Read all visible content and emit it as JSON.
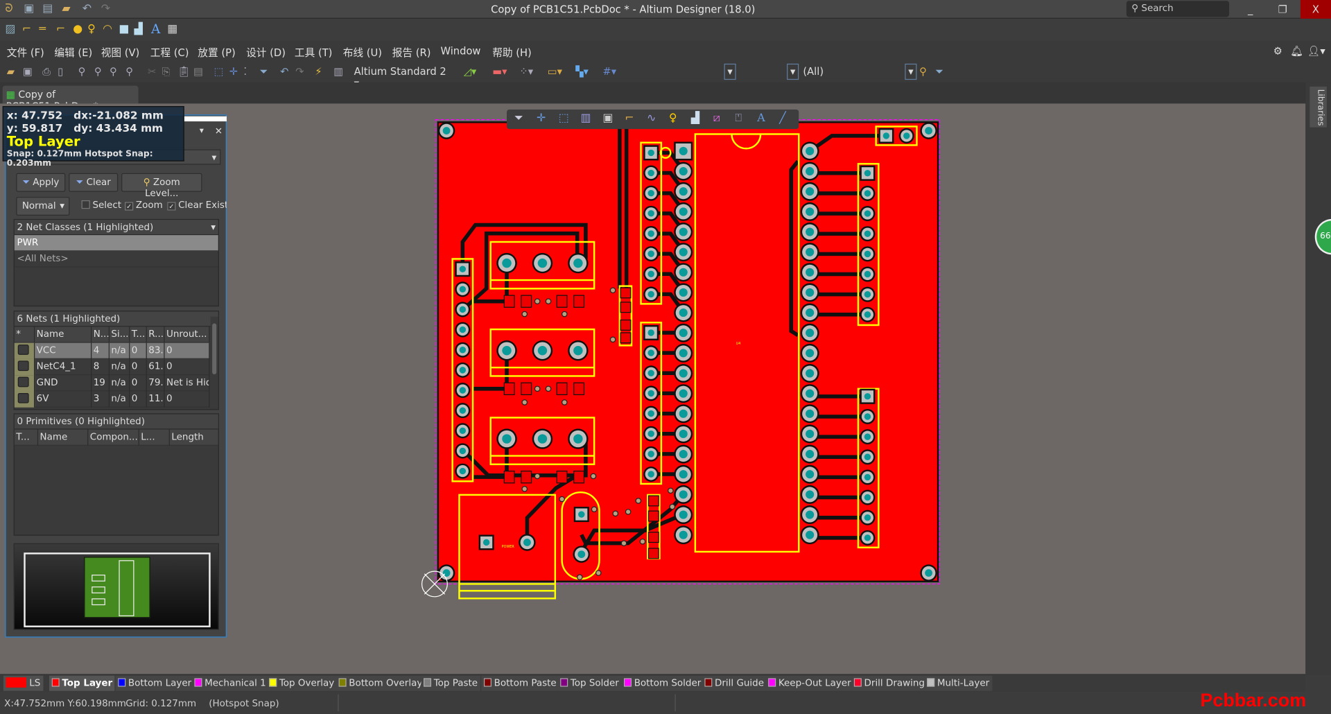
{
  "window": {
    "title": "Copy of PCB1C51.PcbDoc * - Altium Designer (18.0)",
    "search_placeholder": "Search",
    "minimize": "_",
    "restore": "❐",
    "close": "X"
  },
  "menu": [
    "文件 (F)",
    "编辑 (E)",
    "视图 (V)",
    "工程 (C)",
    "放置 (P)",
    "设计 (D)",
    "工具 (T)",
    "布线 (U)",
    "报告 (R)",
    "Window",
    "帮助 (H)"
  ],
  "toolbar": {
    "standard_combo": "Altium Standard 2",
    "filter_combo": "(All)"
  },
  "document_tab": "Copy of PCB1C51.PcbDoc *",
  "side_tab": "Libraries",
  "side_widget": "66",
  "hud": {
    "x": "x: 47.752",
    "dx": "dx:-21.082 mm",
    "y": "y: 59.817",
    "dy": "dy: 43.434 mm",
    "layer": "Top Layer",
    "snap": "Snap: 0.127mm Hotspot Snap: 0.203mm"
  },
  "panel": {
    "apply": "Apply",
    "clear": "Clear",
    "zoom_level": "Zoom Level...",
    "mode": "Normal",
    "select": "Select",
    "zoom": "Zoom",
    "clear_existing": "Clear Existing",
    "select_checked": false,
    "zoom_checked": true,
    "clear_existing_checked": true,
    "net_classes": {
      "header": "2 Net Classes (1 Highlighted)",
      "items": [
        "PWR",
        "<All Nets>"
      ],
      "selected": "PWR"
    },
    "nets": {
      "header": "6 Nets (1 Highlighted)",
      "columns": [
        "*",
        "Name",
        "N...",
        "Si...",
        "T...",
        "R...",
        "Unrout..."
      ],
      "rows": [
        [
          "VCC",
          "4",
          "n/a",
          "0",
          "83.:",
          "0"
        ],
        [
          "NetC4_1",
          "8",
          "n/a",
          "0",
          "61.",
          "0"
        ],
        [
          "GND",
          "19",
          "n/a",
          "0",
          "79.:",
          "Net is Hid"
        ],
        [
          "6V",
          "3",
          "n/a",
          "0",
          "11.:",
          "0"
        ]
      ]
    },
    "primitives": {
      "header": "0 Primitives (0 Highlighted)",
      "columns": [
        "T...",
        "Name",
        "Compon...",
        "L...",
        "Length"
      ]
    }
  },
  "pcb": {
    "designators": {
      "ic": "U4",
      "power": "POWER"
    }
  },
  "layers": {
    "ls": "LS",
    "active": "Top Layer",
    "tabs": [
      {
        "name": "Top Layer",
        "color": "#ff0000"
      },
      {
        "name": "Bottom Layer",
        "color": "#0000ff"
      },
      {
        "name": "Mechanical 1",
        "color": "#ff00ff"
      },
      {
        "name": "Top Overlay",
        "color": "#ffff00"
      },
      {
        "name": "Bottom Overlay",
        "color": "#808000"
      },
      {
        "name": "Top Paste",
        "color": "#808080"
      },
      {
        "name": "Bottom Paste",
        "color": "#800000"
      },
      {
        "name": "Top Solder",
        "color": "#800080"
      },
      {
        "name": "Bottom Solder",
        "color": "#ff00ff"
      },
      {
        "name": "Drill Guide",
        "color": "#800000"
      },
      {
        "name": "Keep-Out Layer",
        "color": "#ff00ff"
      },
      {
        "name": "Drill Drawing",
        "color": "#ff002a"
      },
      {
        "name": "Multi-Layer",
        "color": "#c0c0c0"
      }
    ]
  },
  "status": {
    "coords": "X:47.752mm Y:60.198mm",
    "grid": "Grid: 0.127mm",
    "snap": "(Hotspot Snap)"
  },
  "watermark": "Pcbbar.com"
}
